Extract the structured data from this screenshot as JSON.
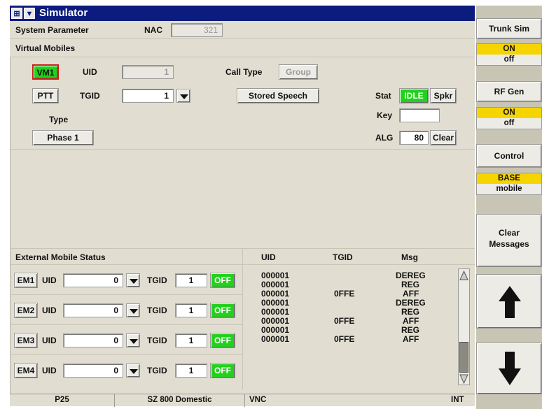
{
  "window": {
    "title": "Simulator",
    "restore_glyph": "Ѡ"
  },
  "system": {
    "label": "System Parameter",
    "nac_label": "NAC",
    "nac_value": "321"
  },
  "virtual_mobiles": {
    "label": "Virtual Mobiles",
    "vm_button": "VM1",
    "uid_label": "UID",
    "uid_value": "1",
    "call_type_label": "Call Type",
    "call_type_value": "Group",
    "ptt_button": "PTT",
    "tgid_label": "TGID",
    "tgid_value": "1",
    "stored_speech_button": "Stored Speech",
    "stat_label": "Stat",
    "stat_value": "IDLE",
    "spkr_button": "Spkr",
    "key_label": "Key",
    "key_value": "",
    "type_label": "Type",
    "type_button": "Phase 1",
    "alg_label": "ALG",
    "alg_value": "80",
    "clear_button": "Clear"
  },
  "external": {
    "label": "External Mobile Status",
    "rows": [
      {
        "name": "EM1",
        "uid_label": "UID",
        "uid": "0",
        "tgid_label": "TGID",
        "tgid": "1",
        "status": "OFF"
      },
      {
        "name": "EM2",
        "uid_label": "UID",
        "uid": "0",
        "tgid_label": "TGID",
        "tgid": "1",
        "status": "OFF"
      },
      {
        "name": "EM3",
        "uid_label": "UID",
        "uid": "0",
        "tgid_label": "TGID",
        "tgid": "1",
        "status": "OFF"
      },
      {
        "name": "EM4",
        "uid_label": "UID",
        "uid": "0",
        "tgid_label": "TGID",
        "tgid": "1",
        "status": "OFF"
      }
    ]
  },
  "log": {
    "headers": {
      "uid": "UID",
      "tgid": "TGID",
      "msg": "Msg"
    },
    "rows": [
      {
        "uid": "000001",
        "tgid": "",
        "msg": "DEREG"
      },
      {
        "uid": "000001",
        "tgid": "",
        "msg": "REG"
      },
      {
        "uid": "000001",
        "tgid": "0FFE",
        "msg": "AFF"
      },
      {
        "uid": "000001",
        "tgid": "",
        "msg": "DEREG"
      },
      {
        "uid": "000001",
        "tgid": "",
        "msg": "REG"
      },
      {
        "uid": "000001",
        "tgid": "0FFE",
        "msg": "AFF"
      },
      {
        "uid": "000001",
        "tgid": "",
        "msg": "REG"
      },
      {
        "uid": "000001",
        "tgid": "0FFE",
        "msg": "AFF"
      }
    ]
  },
  "statusbar": {
    "mode": "P25",
    "system": "SZ 800 Domestic",
    "vnc": "VNC",
    "int": "INT"
  },
  "side": {
    "trunk_sim": {
      "title": "Trunk Sim",
      "on": "ON",
      "off": "off"
    },
    "rf_gen": {
      "title": "RF Gen",
      "on": "ON",
      "off": "off"
    },
    "control": {
      "title": "Control",
      "base": "BASE",
      "mobile": "mobile"
    },
    "clear_messages": "Clear Messages",
    "up_icon": "arrow-up-icon",
    "down_icon": "arrow-down-icon"
  },
  "colors": {
    "title_bar": "#0c1c7e",
    "active_green": "#22d11c",
    "toggle_yellow": "#f5d400",
    "vm_outline": "#c8201c"
  }
}
